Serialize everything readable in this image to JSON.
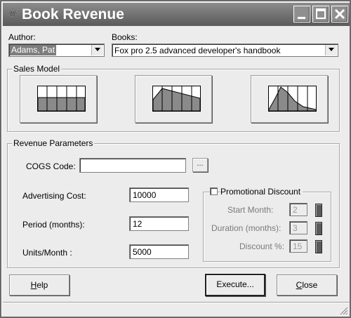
{
  "window": {
    "title": "Book Revenue",
    "app_icon": "book-revenue-app-icon"
  },
  "author": {
    "label": "Author:",
    "value": "Adams, Pat"
  },
  "books": {
    "label": "Books:",
    "value": "Fox pro 2.5 advanced developer's handbook"
  },
  "sales_model": {
    "title": "Sales Model",
    "buttons": [
      {
        "name": "flat",
        "icon": "flat-sales-chart-icon"
      },
      {
        "name": "declining",
        "icon": "declining-sales-chart-icon"
      },
      {
        "name": "peak",
        "icon": "peak-sales-chart-icon"
      }
    ]
  },
  "revenue": {
    "title": "Revenue Parameters",
    "cogs_label": "COGS Code:",
    "cogs_value": "",
    "browse_label": "...",
    "advertising_label": "Advertising Cost:",
    "advertising_value": "10000",
    "period_label": "Period (months):",
    "period_value": "12",
    "units_label": "Units/Month :",
    "units_value": "5000"
  },
  "promo": {
    "label": "Promotional Discount",
    "checked": false,
    "start_label": "Start Month:",
    "start_value": "2",
    "duration_label": "Duration (months):",
    "duration_value": "3",
    "discount_label": "Discount %:",
    "discount_value": "15"
  },
  "buttons": {
    "help": {
      "prefix": "",
      "accel": "H",
      "rest": "elp"
    },
    "execute": {
      "label": "Execute..."
    },
    "close": {
      "prefix": "",
      "accel": "C",
      "rest": "lose"
    }
  }
}
